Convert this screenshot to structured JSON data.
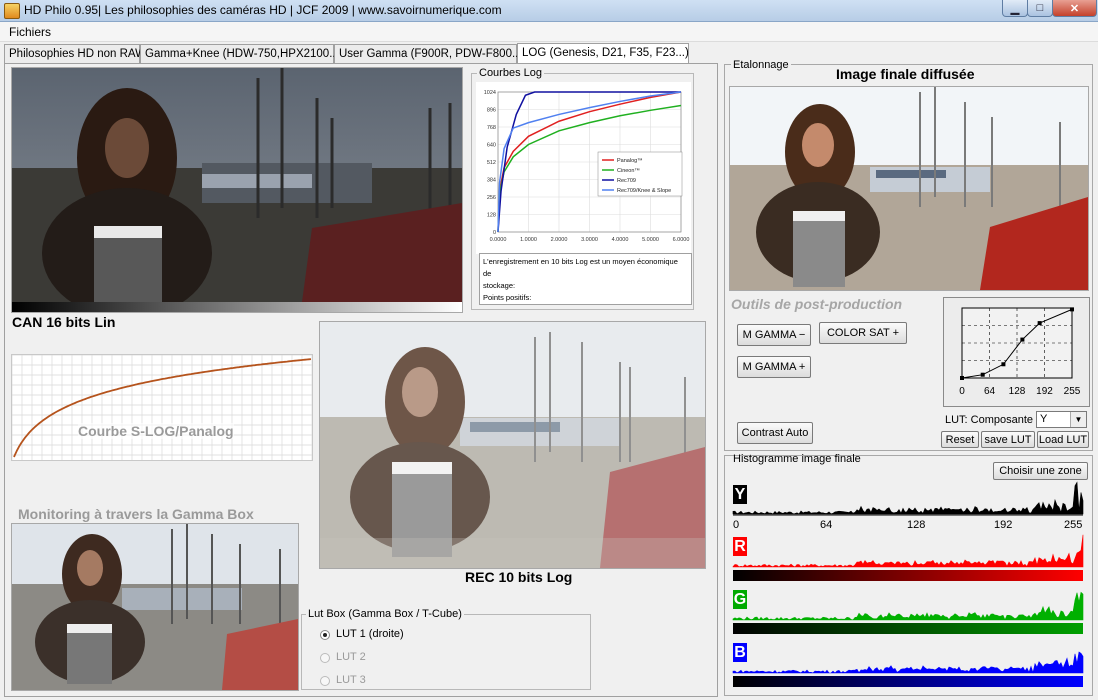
{
  "window": {
    "title": "HD Philo 0.95| Les philosophies des caméras HD | JCF 2009 | www.savoirnumerique.com",
    "minimize_glyph": "▁",
    "maximize_glyph": "□",
    "close_glyph": "✕"
  },
  "menu": {
    "items": [
      "Fichiers"
    ]
  },
  "tabs": [
    {
      "label": "Philosophies HD non RAW",
      "active": false
    },
    {
      "label": "Gamma+Knee (HDW-750,HPX2100...)",
      "active": false
    },
    {
      "label": "User Gamma (F900R, PDW-F800...",
      "active": false
    },
    {
      "label": "LOG (Genesis, D21, F35, F23...)",
      "active": true
    }
  ],
  "left": {
    "can_caption": "CAN 16 bits Lin",
    "curve_caption": "Courbe S-LOG/Panalog",
    "monitoring_caption": "Monitoring à travers la Gamma Box",
    "rec_caption": "REC 10 bits Log",
    "courbes_log": {
      "title": "Courbes Log",
      "description_line1": "L'enregistrement en 10 bits Log est un moyen économique de",
      "description_line2": "stockage:",
      "description_line3": "Points positifs:"
    },
    "lut_box": {
      "title": "Lut Box (Gamma Box / T-Cube)",
      "options": [
        {
          "label": "LUT 1 (droite)",
          "selected": true,
          "enabled": true
        },
        {
          "label": "LUT 2",
          "selected": false,
          "enabled": false
        },
        {
          "label": "LUT 3",
          "selected": false,
          "enabled": false
        }
      ]
    }
  },
  "chart_data": {
    "type": "line",
    "title": "",
    "xlabel": "",
    "ylabel": "",
    "xlim": [
      0,
      6
    ],
    "ylim": [
      0,
      1024
    ],
    "x_ticks": [
      "0.0000",
      "1.0000",
      "2.0000",
      "3.0000",
      "4.0000",
      "5.0000",
      "6.0000"
    ],
    "y_ticks": [
      "0",
      "128",
      "256",
      "384",
      "512",
      "640",
      "768",
      "896",
      "1024"
    ],
    "legend_position": "center-right",
    "series": [
      {
        "name": "Panalog™",
        "color": "#e02020",
        "x": [
          0,
          0.05,
          0.2,
          0.5,
          1,
          2,
          3,
          4,
          5,
          6
        ],
        "values": [
          0,
          300,
          470,
          590,
          700,
          810,
          880,
          935,
          985,
          1024
        ]
      },
      {
        "name": "Cineon™",
        "color": "#20b020",
        "x": [
          0,
          0.05,
          0.2,
          0.5,
          1,
          2,
          3,
          4,
          5,
          6
        ],
        "values": [
          0,
          280,
          440,
          550,
          640,
          740,
          800,
          850,
          890,
          925
        ]
      },
      {
        "name": "Rec709",
        "color": "#1010a0",
        "x": [
          0,
          0.1,
          0.3,
          0.6,
          0.9,
          1.2,
          6
        ],
        "values": [
          0,
          300,
          620,
          860,
          1000,
          1024,
          1024
        ]
      },
      {
        "name": "Rec709/Knee & Slope",
        "color": "#5080f0",
        "x": [
          0,
          0.05,
          0.2,
          0.5,
          1,
          2,
          3,
          4,
          5,
          6
        ],
        "values": [
          0,
          360,
          610,
          760,
          800,
          860,
          910,
          955,
          995,
          1024
        ]
      }
    ]
  },
  "right": {
    "etalonnage_title": "Etalonnage",
    "final_image_caption": "Image finale diffusée",
    "tools_caption": "Outils de post-production",
    "m_gamma_minus": "M GAMMA −",
    "color_sat_plus": "COLOR SAT +",
    "m_gamma_plus": "M GAMMA +",
    "contrast_auto": "Contrast Auto",
    "lut_component_label": "LUT: Composante",
    "lut_component_value": "Y",
    "reset": "Reset",
    "save_lut": "save LUT",
    "load_lut": "Load LUT",
    "lut_curve_ticks": [
      "0",
      "64",
      "128",
      "192",
      "255"
    ],
    "lut_curve_points": [
      [
        0,
        0
      ],
      [
        48,
        12
      ],
      [
        96,
        50
      ],
      [
        140,
        140
      ],
      [
        180,
        200
      ],
      [
        255,
        250
      ]
    ]
  },
  "histogram": {
    "title": "Histogramme image finale",
    "choose_zone": "Choisir une zone",
    "ticks": [
      "0",
      "64",
      "128",
      "192",
      "255"
    ],
    "channels": [
      {
        "letter": "Y",
        "bg": "#000000",
        "color": "#000000"
      },
      {
        "letter": "R",
        "bg": "#ff0000",
        "color": "#ff0000"
      },
      {
        "letter": "G",
        "bg": "#00a000",
        "color": "#00b000"
      },
      {
        "letter": "B",
        "bg": "#0000ff",
        "color": "#0000ff"
      }
    ]
  },
  "colors": {
    "accent_red": "#c0392b",
    "curve_orange": "#b5531c",
    "grid": "#d8d8d8"
  }
}
